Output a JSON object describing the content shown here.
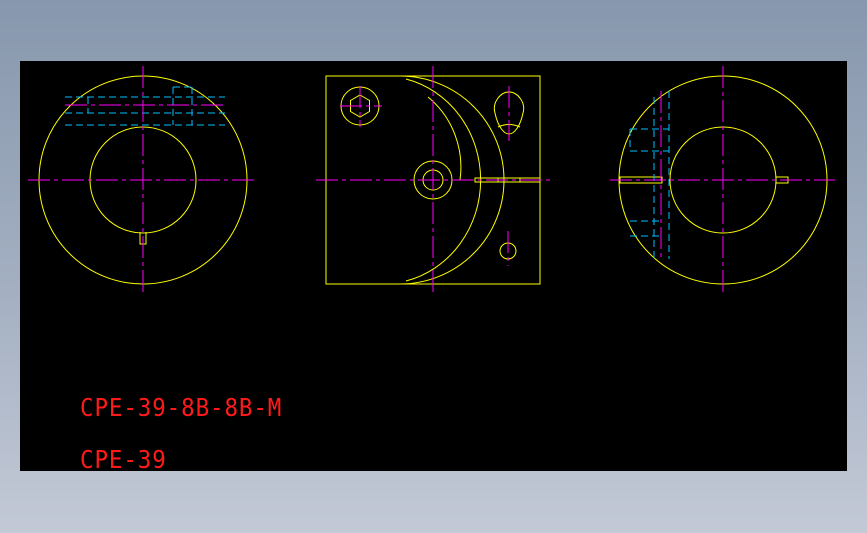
{
  "colors": {
    "background": "#000000",
    "outline": "#ffff00",
    "centerline": "#ff00ff",
    "hidden": "#00bfff",
    "text": "#ff1a1a"
  },
  "labels": {
    "part_code": "CPE-39-8B-8B-M",
    "series_code": "CPE-39"
  }
}
